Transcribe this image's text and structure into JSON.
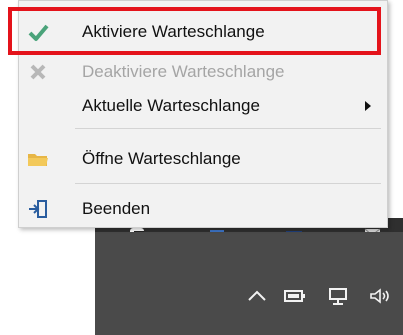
{
  "menu": {
    "items": [
      {
        "label": "Aktiviere Warteschlange",
        "icon": "check-icon",
        "enabled": true
      },
      {
        "label": "Deaktiviere Warteschlange",
        "icon": "x-icon",
        "enabled": false
      },
      {
        "label": "Aktuelle Warteschlange",
        "icon": "",
        "enabled": true,
        "submenu": true
      },
      {
        "label": "Öffne Warteschlange",
        "icon": "folder-icon",
        "enabled": true
      },
      {
        "label": "Beenden",
        "icon": "exit-icon",
        "enabled": true
      }
    ]
  },
  "taskbar": {
    "tray_icons": [
      "chevron-up-icon",
      "battery-icon",
      "network-icon",
      "volume-icon"
    ]
  },
  "colors": {
    "highlight": "#e4131b",
    "check": "#4aa37a",
    "folder": "#e7b646",
    "menu_bg": "#f2f2f2",
    "taskbar": "#4a4a4a"
  }
}
